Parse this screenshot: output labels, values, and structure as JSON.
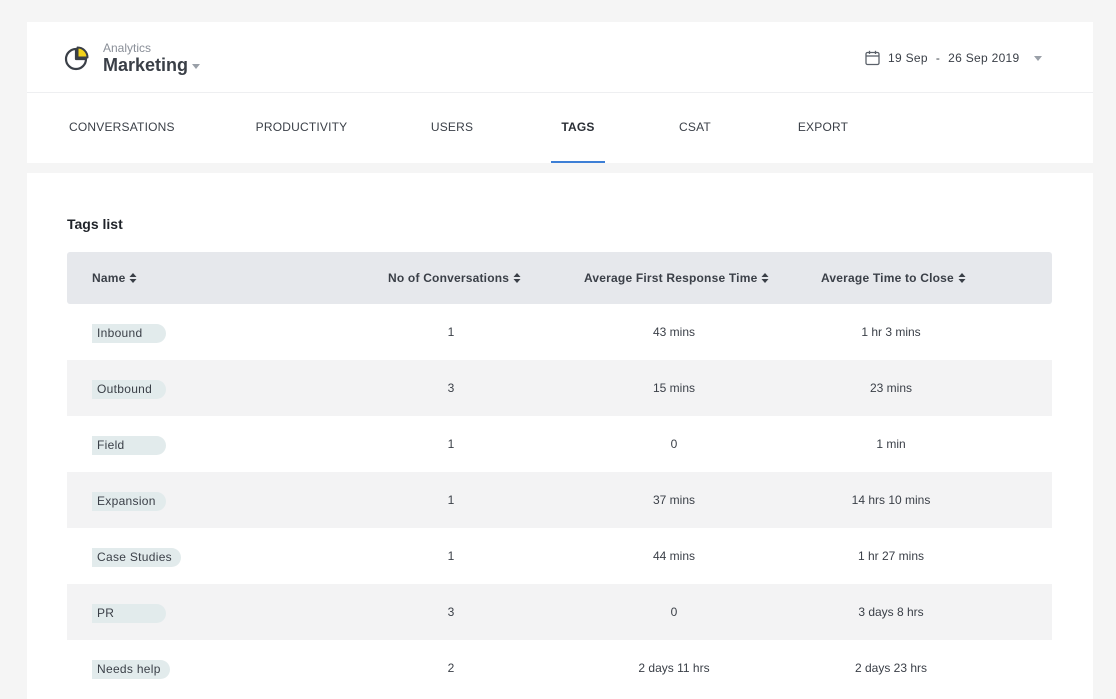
{
  "header": {
    "subtitle": "Analytics",
    "title": "Marketing",
    "date_start": "19 Sep",
    "date_sep": "-",
    "date_end": "26 Sep 2019"
  },
  "tabs": [
    {
      "label": "CONVERSATIONS"
    },
    {
      "label": "PRODUCTIVITY"
    },
    {
      "label": "USERS"
    },
    {
      "label": "TAGS"
    },
    {
      "label": "CSAT"
    },
    {
      "label": "EXPORT"
    }
  ],
  "active_tab": "TAGS",
  "section": {
    "title": "Tags list"
  },
  "table": {
    "columns": [
      "Name",
      "No of Conversations",
      "Average First Response Time",
      "Average Time to Close"
    ],
    "rows": [
      {
        "name": "Inbound",
        "conversations": "1",
        "first_response": "43 mins",
        "time_to_close": "1 hr 3 mins"
      },
      {
        "name": "Outbound",
        "conversations": "3",
        "first_response": "15 mins",
        "time_to_close": "23 mins"
      },
      {
        "name": "Field",
        "conversations": "1",
        "first_response": "0",
        "time_to_close": "1 min"
      },
      {
        "name": "Expansion",
        "conversations": "1",
        "first_response": "37 mins",
        "time_to_close": "14 hrs 10 mins"
      },
      {
        "name": "Case Studies",
        "conversations": "1",
        "first_response": "44 mins",
        "time_to_close": "1 hr 27 mins"
      },
      {
        "name": "PR",
        "conversations": "3",
        "first_response": "0",
        "time_to_close": "3 days 8 hrs"
      },
      {
        "name": "Needs help",
        "conversations": "2",
        "first_response": "2 days 11 hrs",
        "time_to_close": "2 days 23 hrs"
      }
    ]
  },
  "colors": {
    "accent": "#3d7fd6",
    "logo_yellow": "#f2d21b",
    "tag_bg": "#e2ebec",
    "header_row_bg": "#e6e8ec"
  },
  "icons": [
    "analytics-pie-icon",
    "calendar-icon",
    "chevron-down-icon",
    "sort-icon"
  ]
}
